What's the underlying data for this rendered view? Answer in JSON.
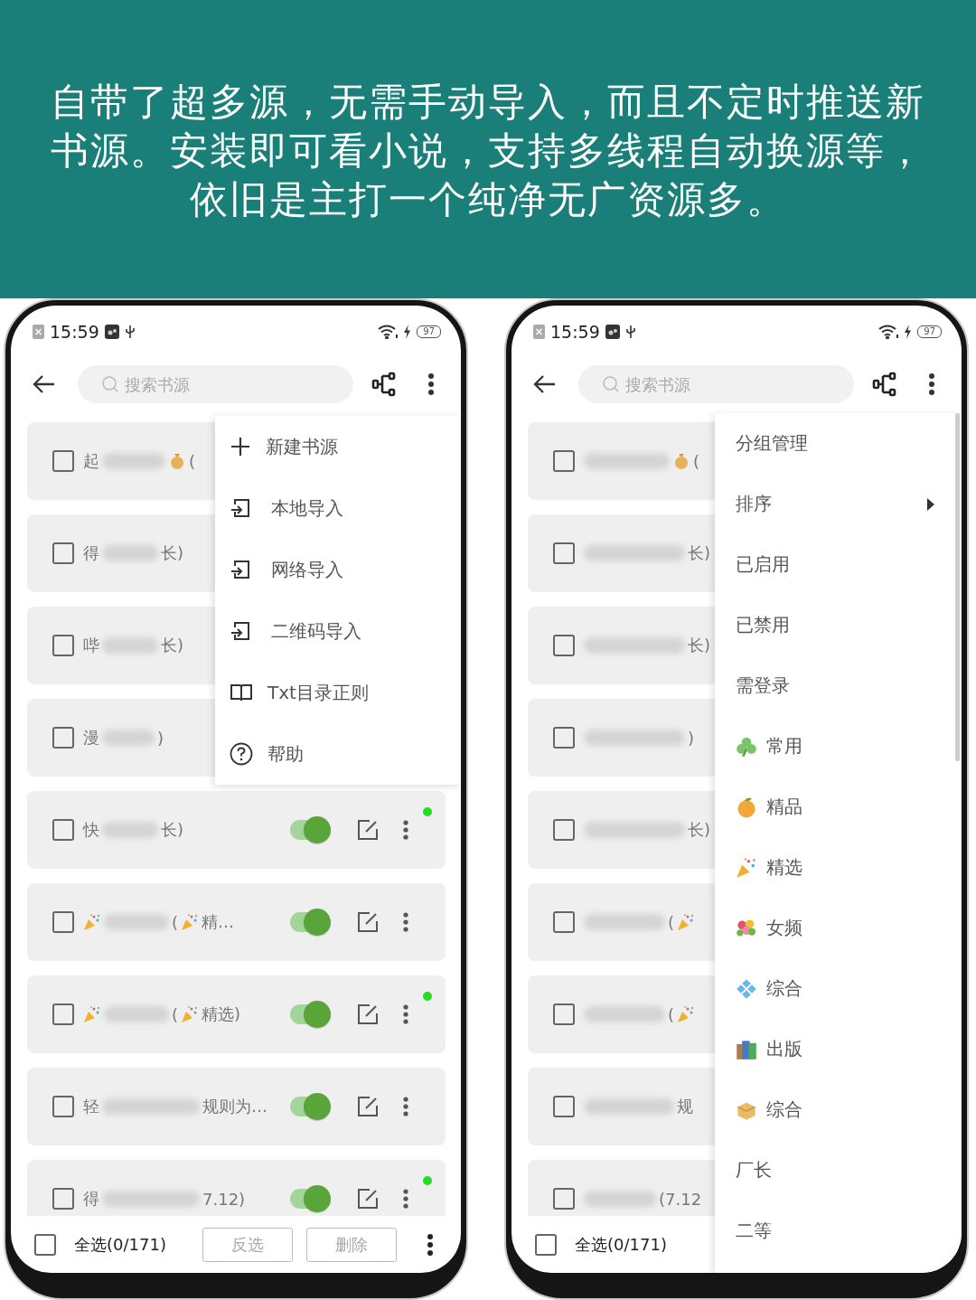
{
  "banner": {
    "lines": [
      "自带了超多源，无需手动导入，而且不定时推送新",
      "书源。安装即可看小说，支持多线程自动换源等，",
      "依旧是主打一个纯净无广资源多。"
    ]
  },
  "phones": [
    {
      "status_bar": {
        "time": "15:59",
        "battery": "97"
      },
      "search": {
        "placeholder": "搜索书源"
      },
      "rows": [
        {
          "checked": false,
          "parts": [
            {
              "kind": "text",
              "text": "起"
            },
            {
              "kind": "blur"
            },
            {
              "kind": "money"
            },
            {
              "kind": "text",
              "text": "("
            }
          ]
        },
        {
          "checked": false,
          "parts": [
            {
              "kind": "text",
              "text": "得"
            },
            {
              "kind": "blur"
            },
            {
              "kind": "text",
              "text": "长)"
            }
          ]
        },
        {
          "checked": false,
          "parts": [
            {
              "kind": "text",
              "text": "哔"
            },
            {
              "kind": "blur"
            },
            {
              "kind": "text",
              "text": "长)"
            }
          ]
        },
        {
          "checked": false,
          "parts": [
            {
              "kind": "text",
              "text": "漫"
            },
            {
              "kind": "blur"
            },
            {
              "kind": "text",
              "text": ")"
            }
          ]
        },
        {
          "checked": false,
          "on": true,
          "dot": true,
          "parts": [
            {
              "kind": "text",
              "text": "快"
            },
            {
              "kind": "blur"
            },
            {
              "kind": "text",
              "text": "长)"
            }
          ]
        },
        {
          "checked": false,
          "on": true,
          "dot": false,
          "parts": [
            {
              "kind": "party"
            },
            {
              "kind": "blur"
            },
            {
              "kind": "text",
              "text": "("
            },
            {
              "kind": "party"
            },
            {
              "kind": "text",
              "text": "精…"
            }
          ]
        },
        {
          "checked": false,
          "on": true,
          "dot": true,
          "parts": [
            {
              "kind": "party"
            },
            {
              "kind": "blur"
            },
            {
              "kind": "text",
              "text": "("
            },
            {
              "kind": "party"
            },
            {
              "kind": "text",
              "text": "精选)"
            }
          ]
        },
        {
          "checked": false,
          "on": true,
          "dot": false,
          "parts": [
            {
              "kind": "text",
              "text": "轻"
            },
            {
              "kind": "blur"
            },
            {
              "kind": "text",
              "text": "规则为…"
            }
          ]
        },
        {
          "checked": false,
          "on": true,
          "dot": true,
          "parts": [
            {
              "kind": "text",
              "text": "得"
            },
            {
              "kind": "blur"
            },
            {
              "kind": "text",
              "text": "7.12)"
            }
          ]
        }
      ],
      "menu": {
        "items": [
          {
            "kind": "plus",
            "label": "新建书源",
            "submenu": false
          },
          {
            "kind": "import",
            "label": "本地导入",
            "submenu": false
          },
          {
            "kind": "import",
            "label": "网络导入",
            "submenu": false
          },
          {
            "kind": "import",
            "label": "二维码导入",
            "submenu": false
          },
          {
            "kind": "book",
            "label": "Txt目录正则",
            "submenu": false
          },
          {
            "kind": "help",
            "label": "帮助",
            "submenu": false
          }
        ]
      },
      "bottom_bar": {
        "checked": false,
        "label": "全选(0/171)",
        "buttons": [
          {
            "label": "反选",
            "disabled": true
          },
          {
            "label": "删除",
            "disabled": true
          }
        ]
      }
    },
    {
      "status_bar": {
        "time": "15:59",
        "battery": "97"
      },
      "search": {
        "placeholder": "搜索书源"
      },
      "rows": [
        {
          "checked": false,
          "parts": [
            {
              "kind": "blur"
            },
            {
              "kind": "money"
            },
            {
              "kind": "text",
              "text": "("
            }
          ]
        },
        {
          "checked": false,
          "parts": [
            {
              "kind": "blur"
            },
            {
              "kind": "text",
              "text": "长)"
            }
          ]
        },
        {
          "checked": false,
          "parts": [
            {
              "kind": "blur"
            },
            {
              "kind": "text",
              "text": "长)"
            }
          ]
        },
        {
          "checked": false,
          "parts": [
            {
              "kind": "blur"
            },
            {
              "kind": "text",
              "text": ")"
            }
          ]
        },
        {
          "checked": false,
          "parts": [
            {
              "kind": "blur"
            },
            {
              "kind": "text",
              "text": "长)"
            }
          ]
        },
        {
          "checked": false,
          "parts": [
            {
              "kind": "blur"
            },
            {
              "kind": "text",
              "text": "("
            },
            {
              "kind": "party"
            }
          ]
        },
        {
          "checked": false,
          "parts": [
            {
              "kind": "blur"
            },
            {
              "kind": "text",
              "text": "("
            },
            {
              "kind": "party"
            }
          ]
        },
        {
          "checked": false,
          "parts": [
            {
              "kind": "blur"
            },
            {
              "kind": "text",
              "text": "规"
            }
          ]
        },
        {
          "checked": false,
          "parts": [
            {
              "kind": "blur"
            },
            {
              "kind": "text",
              "text": "(7.12"
            }
          ]
        }
      ],
      "menu": {
        "items": [
          {
            "kind": "plain",
            "label": "分组管理",
            "submenu": false
          },
          {
            "kind": "plain",
            "label": "排序",
            "submenu": true
          },
          {
            "kind": "plain",
            "label": "已启用",
            "submenu": false
          },
          {
            "kind": "plain",
            "label": "已禁用",
            "submenu": false
          },
          {
            "kind": "plain",
            "label": "需登录",
            "submenu": false
          },
          {
            "kind": "clover",
            "label": "常用",
            "submenu": false
          },
          {
            "kind": "orange",
            "label": "精品",
            "submenu": false
          },
          {
            "kind": "party",
            "label": "精选",
            "submenu": false
          },
          {
            "kind": "bouquet",
            "label": "女频",
            "submenu": false
          },
          {
            "kind": "tiles",
            "label": "综合",
            "submenu": false
          },
          {
            "kind": "books",
            "label": "出版",
            "submenu": false
          },
          {
            "kind": "package",
            "label": "综合",
            "submenu": false
          },
          {
            "kind": "plain",
            "label": "厂长",
            "submenu": false
          },
          {
            "kind": "plain",
            "label": "二等",
            "submenu": false
          }
        ]
      },
      "bottom_bar": {
        "checked": false,
        "label": "全选(0/171)"
      }
    }
  ]
}
